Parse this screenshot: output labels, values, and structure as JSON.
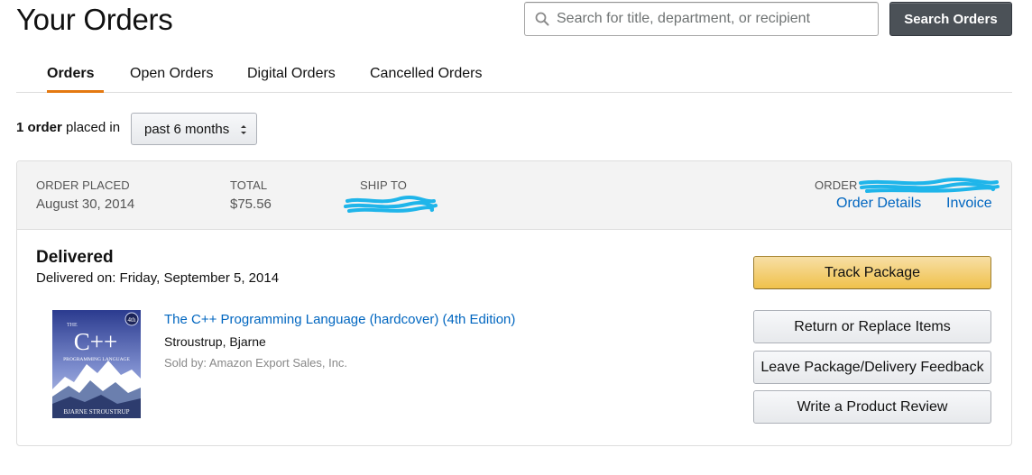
{
  "page": {
    "title": "Your Orders"
  },
  "search": {
    "placeholder": "Search for title, department, or recipient",
    "button_label": "Search Orders"
  },
  "tabs": [
    {
      "label": "Orders",
      "active": true
    },
    {
      "label": "Open Orders",
      "active": false
    },
    {
      "label": "Digital Orders",
      "active": false
    },
    {
      "label": "Cancelled Orders",
      "active": false
    }
  ],
  "filter": {
    "count": "1 order",
    "suffix": "placed in",
    "selected_range": "past 6 months"
  },
  "order": {
    "placed_label": "ORDER PLACED",
    "placed_value": "August 30, 2014",
    "total_label": "TOTAL",
    "total_value": "$75.56",
    "ship_to_label": "SHIP TO",
    "order_label": "ORDER",
    "details_link": "Order Details",
    "invoice_link": "Invoice",
    "status": "Delivered",
    "delivered_on": "Delivered on: Friday, September 5, 2014",
    "item": {
      "title": "The C++ Programming Language (hardcover) (4th Edition)",
      "author": "Stroustrup, Bjarne",
      "seller": "Sold by: Amazon Export Sales, Inc.",
      "cover_text": {
        "prefix": "THE",
        "title": "C++",
        "subtitle": "PROGRAMMING LANGUAGE",
        "edition": "4th",
        "author": "BJARNE STROUSTRUP"
      }
    },
    "actions": {
      "track": "Track Package",
      "return": "Return or Replace Items",
      "feedback": "Leave Package/Delivery Feedback",
      "review": "Write a Product Review"
    }
  },
  "colors": {
    "accent_tab": "#e47911",
    "link": "#0066c0",
    "primary_button": "#f0c14b",
    "search_button": "#4b5157",
    "redaction": "#1fb5ea"
  }
}
